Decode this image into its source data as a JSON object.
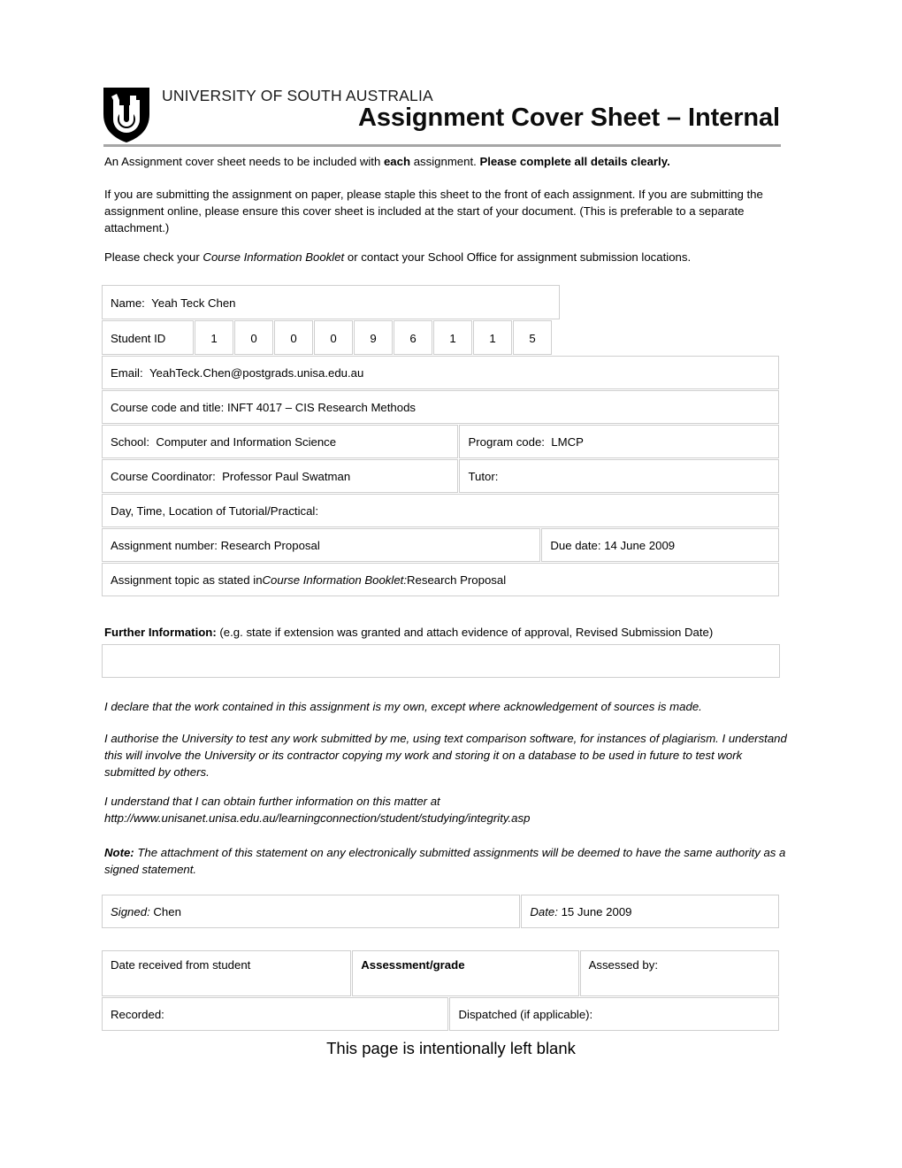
{
  "header": {
    "logo_icon": "unisa-shield-logo",
    "university_name": "UNIVERSITY OF SOUTH AUSTRALIA",
    "document_title": "Assignment Cover Sheet – Internal"
  },
  "intro": {
    "line1_a": "An Assignment cover sheet needs to be included with ",
    "line1_b": "each",
    "line1_c": " assignment. ",
    "line1_d": "Please complete all details clearly.",
    "paragraph2": "If you are submitting the assignment on paper, please staple this sheet to the front of each assignment. If you are submitting the assignment online, please ensure this cover sheet is included at the start of your document. (This is preferable to a separate attachment.)",
    "paragraph3_a": "Please check your ",
    "paragraph3_b": "Course Information Booklet",
    "paragraph3_c": " or contact your School Office for assignment submission locations."
  },
  "form": {
    "name_label": "Name:",
    "name_value": "Yeah Teck Chen",
    "student_id_label": "Student ID",
    "student_id_digits": [
      "1",
      "0",
      "0",
      "0",
      "9",
      "6",
      "1",
      "1",
      "5"
    ],
    "email_label": "Email:",
    "email_value": "YeahTeck.Chen@postgrads.unisa.edu.au",
    "course_label": "Course code and title:",
    "course_value": "INFT 4017 – CIS Research Methods",
    "school_label": "School:",
    "school_value": "Computer and Information Science",
    "program_code_label": "Program code:",
    "program_code_value": "LMCP",
    "coordinator_label": "Course Coordinator:",
    "coordinator_value": "Professor Paul Swatman",
    "tutor_label": "Tutor:",
    "tutor_value": "",
    "tutorial_label": "Day, Time, Location of Tutorial/Practical:",
    "tutorial_value": "",
    "assignment_number_label": "Assignment number:",
    "assignment_number_value": "Research Proposal",
    "due_date_label": "Due date:",
    "due_date_value": "14 June 2009",
    "topic_label_a": "Assignment topic as stated in ",
    "topic_label_b": "Course Information Booklet:",
    "topic_value": " Research Proposal"
  },
  "further_information": {
    "label": "Further Information:",
    "hint": " (e.g. state if extension was granted and attach evidence of approval, Revised Submission Date)",
    "value": ""
  },
  "declaration": {
    "paragraph1": "I declare that the work contained in this assignment is my own, except where acknowledgement of sources is made.",
    "paragraph2": "I authorise the University to test any work submitted by me, using text comparison software, for instances of plagiarism. I understand this will involve the University or its contractor copying my work and storing it on a database to be used in future to test work submitted by others.",
    "paragraph3_line1": "I understand that I can obtain further information on this matter at",
    "paragraph3_line2": "http://www.unisanet.unisa.edu.au/learningconnection/student/studying/integrity.asp",
    "note_label": "Note:",
    "note_text": " The attachment of this statement on any electronically submitted assignments will be deemed to have the same authority as a signed statement."
  },
  "signature": {
    "signed_label": "Signed:",
    "signed_value": "Chen",
    "date_label": "Date:",
    "date_value": "15 June 2009"
  },
  "office_use": {
    "date_received_label": "Date received from student",
    "date_received_value": "",
    "assessment_grade_label": "Assessment/grade",
    "assessment_grade_value": "",
    "assessed_by_label": "Assessed by:",
    "assessed_by_value": "",
    "recorded_label": "Recorded:",
    "recorded_value": "",
    "dispatched_label": "Dispatched (if applicable):",
    "dispatched_value": ""
  },
  "footer": {
    "blank_page_note": "This page is intentionally left blank"
  },
  "colors": {
    "border_gray": "#cfcfcf",
    "rule_gray": "#a6a6a6",
    "text_black": "#000000"
  }
}
